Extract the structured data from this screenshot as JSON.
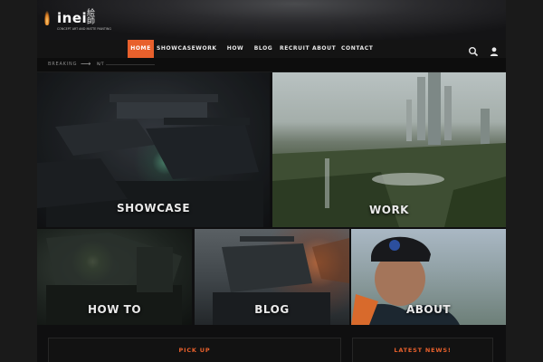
{
  "brand": {
    "logo_text": "inei",
    "logo_kanji": "絵師",
    "logo_tagline": "CONCEPT ART AND MATTE PAINTING"
  },
  "nav": {
    "items": [
      {
        "label": "HOME",
        "active": true
      },
      {
        "label": "SHOWCASE",
        "active": false
      },
      {
        "label": "WORK",
        "active": false
      },
      {
        "label": "HOW TO",
        "active": false
      },
      {
        "label": "BLOG",
        "active": false
      },
      {
        "label": "RECRUIT",
        "active": false
      },
      {
        "label": "ABOUT",
        "active": false
      },
      {
        "label": "CONTACT",
        "active": false
      }
    ],
    "icons": [
      "search-icon",
      "user-icon"
    ],
    "accent_color": "#e8602c"
  },
  "breaking": {
    "label": "BREAKING",
    "ticker_text": "N/T"
  },
  "tiles": {
    "showcase": "SHOWCASE",
    "work": "WORK",
    "howto": "HOW TO",
    "blog": "BLOG",
    "about": "ABOUT"
  },
  "panels": {
    "pickup_title": "PICK UP",
    "news_title": "LATEST NEWS!"
  }
}
